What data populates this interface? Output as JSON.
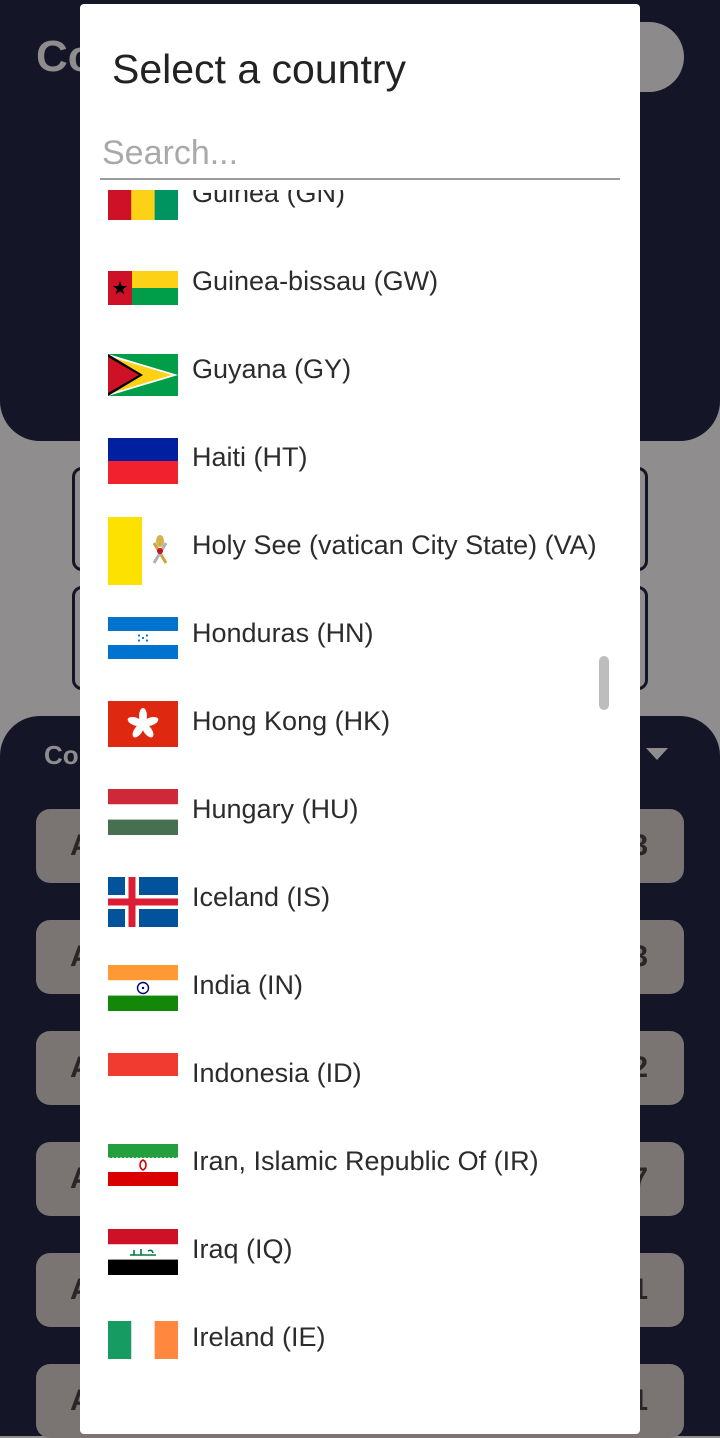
{
  "background": {
    "title_partial": "Co",
    "section_partial": "Co",
    "rows": [
      {
        "left": "A",
        "right": "3"
      },
      {
        "left": "A",
        "right": "3"
      },
      {
        "left": "A",
        "right": "2"
      },
      {
        "left": "A",
        "right": "7"
      },
      {
        "left": "A",
        "right": "1"
      },
      {
        "left": "A",
        "right": "1"
      }
    ]
  },
  "dialog": {
    "title": "Select a country",
    "search_placeholder": "Search...",
    "countries": [
      {
        "name": "Guinea (GN)",
        "flag": "guinea-flag-icon"
      },
      {
        "name": "Guinea-bissau (GW)",
        "flag": "guinea-bissau-flag-icon"
      },
      {
        "name": "Guyana (GY)",
        "flag": "guyana-flag-icon"
      },
      {
        "name": "Haiti (HT)",
        "flag": "haiti-flag-icon"
      },
      {
        "name": "Holy See (vatican City State) (VA)",
        "flag": "vatican-flag-icon"
      },
      {
        "name": "Honduras (HN)",
        "flag": "honduras-flag-icon"
      },
      {
        "name": "Hong Kong (HK)",
        "flag": "hong-kong-flag-icon"
      },
      {
        "name": "Hungary (HU)",
        "flag": "hungary-flag-icon"
      },
      {
        "name": "Iceland (IS)",
        "flag": "iceland-flag-icon"
      },
      {
        "name": "India (IN)",
        "flag": "india-flag-icon"
      },
      {
        "name": "Indonesia (ID)",
        "flag": "indonesia-flag-icon"
      },
      {
        "name": "Iran, Islamic Republic Of (IR)",
        "flag": "iran-flag-icon"
      },
      {
        "name": "Iraq (IQ)",
        "flag": "iraq-flag-icon"
      },
      {
        "name": "Ireland (IE)",
        "flag": "ireland-flag-icon"
      },
      {
        "name": "",
        "flag": "israel-flag-icon"
      }
    ]
  }
}
